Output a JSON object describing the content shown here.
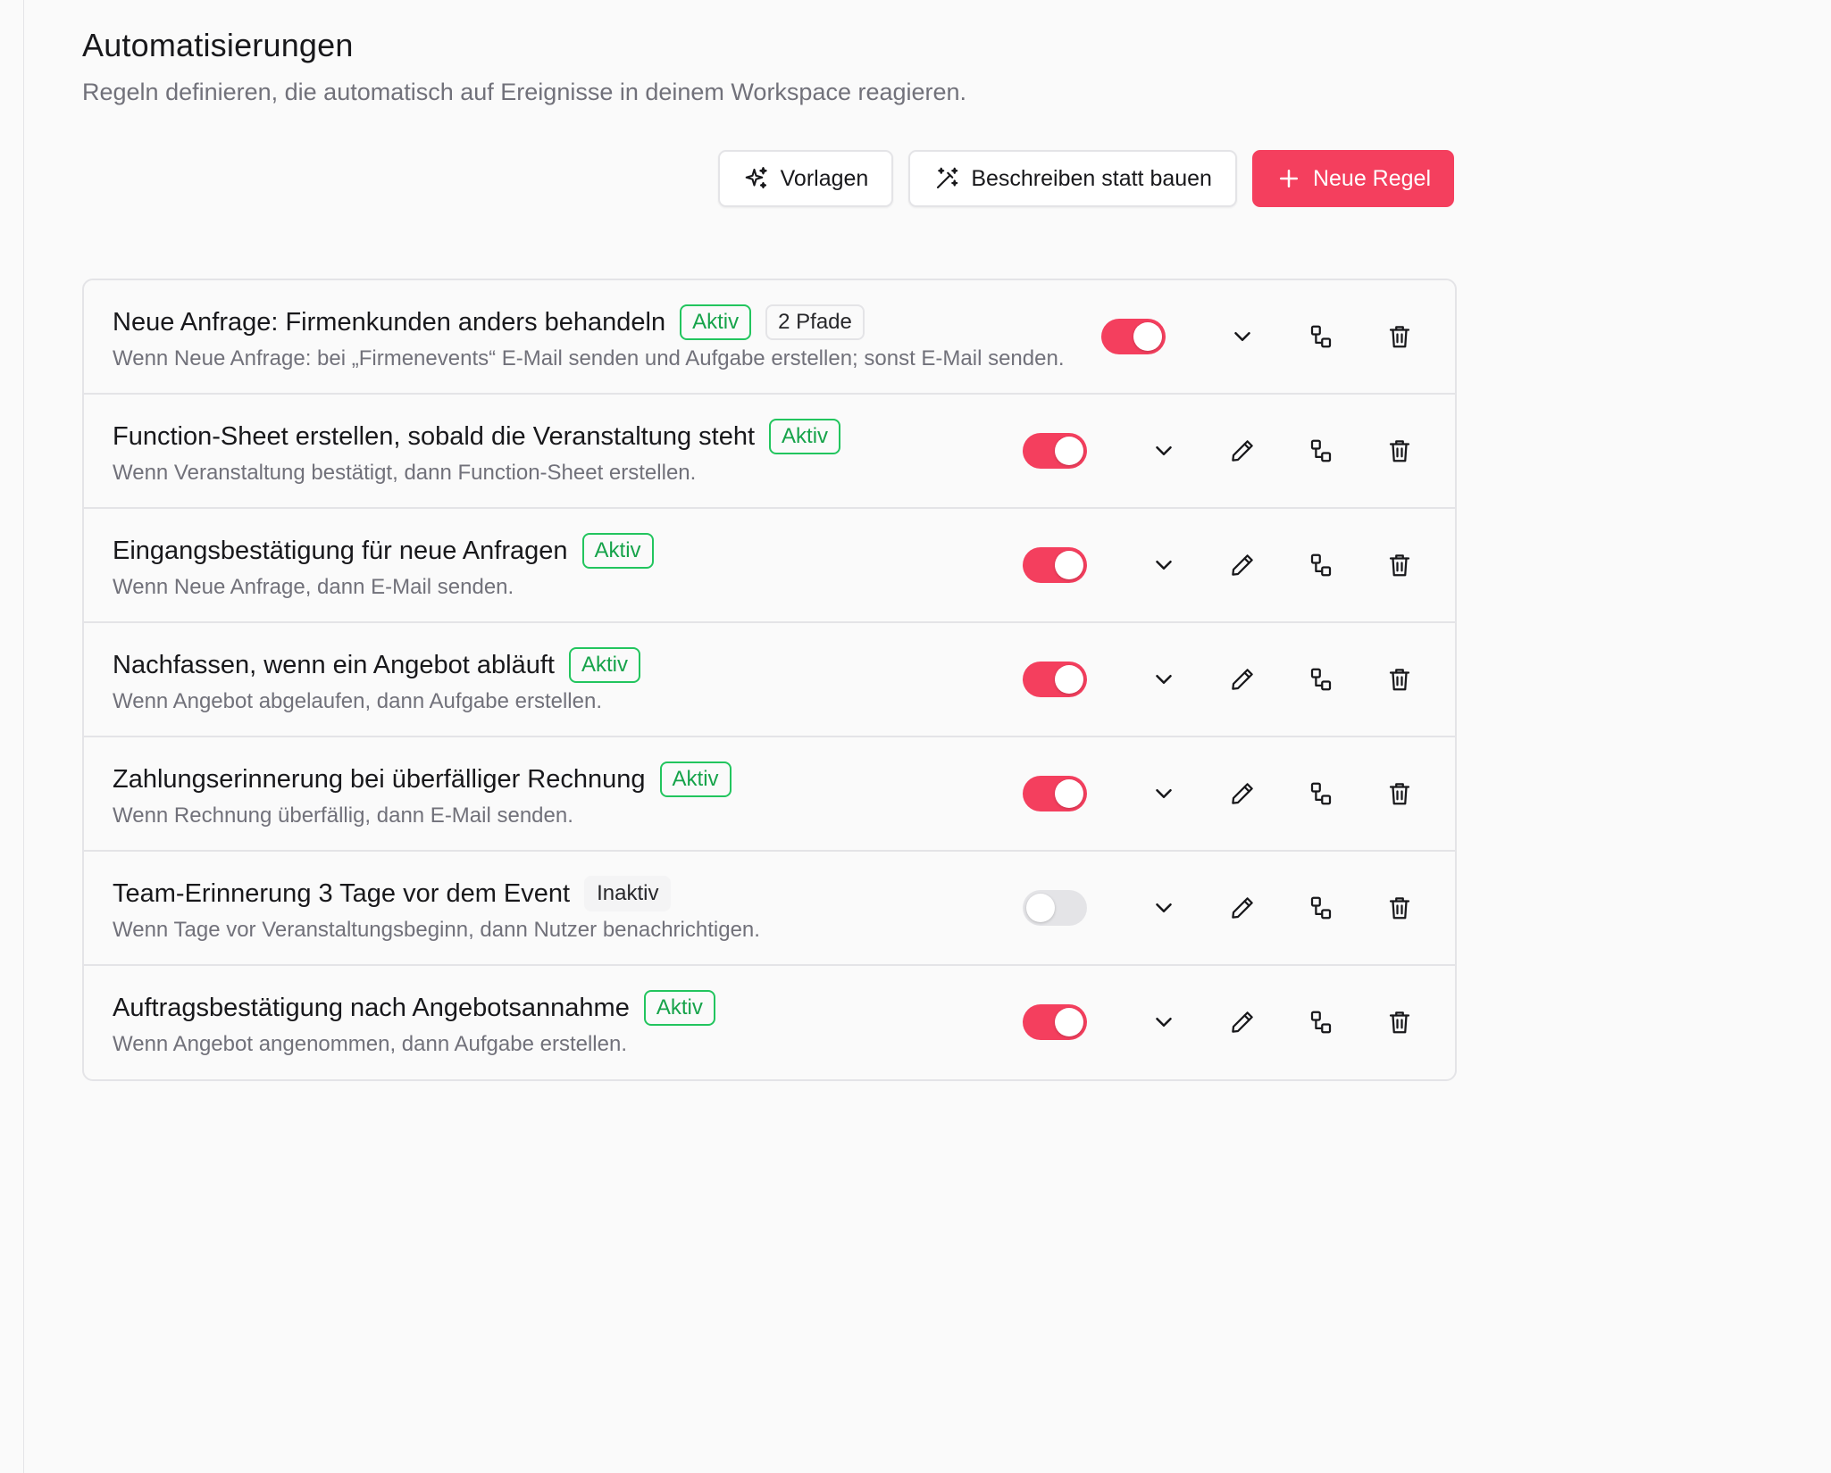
{
  "page": {
    "title": "Automatisierungen",
    "subtitle": "Regeln definieren, die automatisch auf Ereignisse in deinem Workspace reagieren."
  },
  "toolbar": {
    "templates_label": "Vorlagen",
    "templates_icon": "sparkles-icon",
    "describe_label": "Beschreiben statt bauen",
    "describe_icon": "magic-wand-icon",
    "new_rule_label": "Neue Regel",
    "new_rule_icon": "plus-icon"
  },
  "colors": {
    "accent": "#f43f5e",
    "active_badge": "#16a34a",
    "muted_text": "#71717a",
    "border": "#e4e4e7"
  },
  "rules": [
    {
      "title": "Neue Anfrage: Firmenkunden anders behandeln",
      "status": "Aktiv",
      "paths": "2 Pfade",
      "description": "Wenn Neue Anfrage: bei „Firmenevents“ E-Mail senden und Aufgabe erstellen; sonst E-Mail senden.",
      "enabled": true
    },
    {
      "title": "Function-Sheet erstellen, sobald die Veranstaltung steht",
      "status": "Aktiv",
      "description": "Wenn Veranstaltung bestätigt, dann Function-Sheet erstellen.",
      "enabled": true
    },
    {
      "title": "Eingangsbestätigung für neue Anfragen",
      "status": "Aktiv",
      "description": "Wenn Neue Anfrage, dann E-Mail senden.",
      "enabled": true
    },
    {
      "title": "Nachfassen, wenn ein Angebot abläuft",
      "status": "Aktiv",
      "description": "Wenn Angebot abgelaufen, dann Aufgabe erstellen.",
      "enabled": true
    },
    {
      "title": "Zahlungserinnerung bei überfälliger Rechnung",
      "status": "Aktiv",
      "description": "Wenn Rechnung überfällig, dann E-Mail senden.",
      "enabled": true
    },
    {
      "title": "Team-Erinnerung 3 Tage vor dem Event",
      "status": "Inaktiv",
      "description": "Wenn Tage vor Veranstaltungsbeginn, dann Nutzer benachrichtigen.",
      "enabled": false
    },
    {
      "title": "Auftragsbestätigung nach Angebotsannahme",
      "status": "Aktiv",
      "description": "Wenn Angebot angenommen, dann Aufgabe erstellen.",
      "enabled": true
    }
  ],
  "row_action_icons": [
    "chevron-down-icon",
    "pencil-icon",
    "duplicate-icon",
    "trash-icon"
  ]
}
